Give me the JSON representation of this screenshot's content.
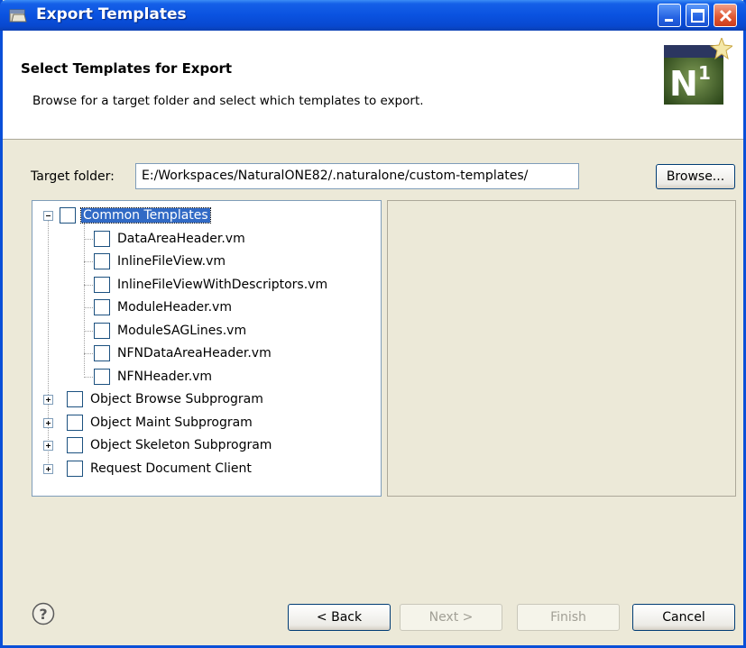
{
  "window": {
    "title": "Export Templates"
  },
  "banner": {
    "title": "Select Templates for Export",
    "description": "Browse for a target folder and select which templates to export.",
    "logo_text": "N1"
  },
  "target": {
    "label": "Target folder:",
    "value": "E:/Workspaces/NaturalONE82/.naturalone/custom-templates/",
    "browse_label": "Browse..."
  },
  "tree": {
    "root": {
      "label": "Common Templates",
      "expanded": true,
      "selected": true
    },
    "children": [
      "DataAreaHeader.vm",
      "InlineFileView.vm",
      "InlineFileViewWithDescriptors.vm",
      "ModuleHeader.vm",
      "ModuleSAGLines.vm",
      "NFNDataAreaHeader.vm",
      "NFNHeader.vm"
    ],
    "collapsed": [
      "Object Browse Subprogram",
      "Object Maint Subprogram",
      "Object Skeleton Subprogram",
      "Request Document Client"
    ]
  },
  "buttons": {
    "back": "< Back",
    "next": "Next >",
    "finish": "Finish",
    "cancel": "Cancel"
  },
  "colors": {
    "titlebar": "#0a52e0",
    "selection": "#316ac5",
    "dialog_bg": "#ece9d8"
  }
}
